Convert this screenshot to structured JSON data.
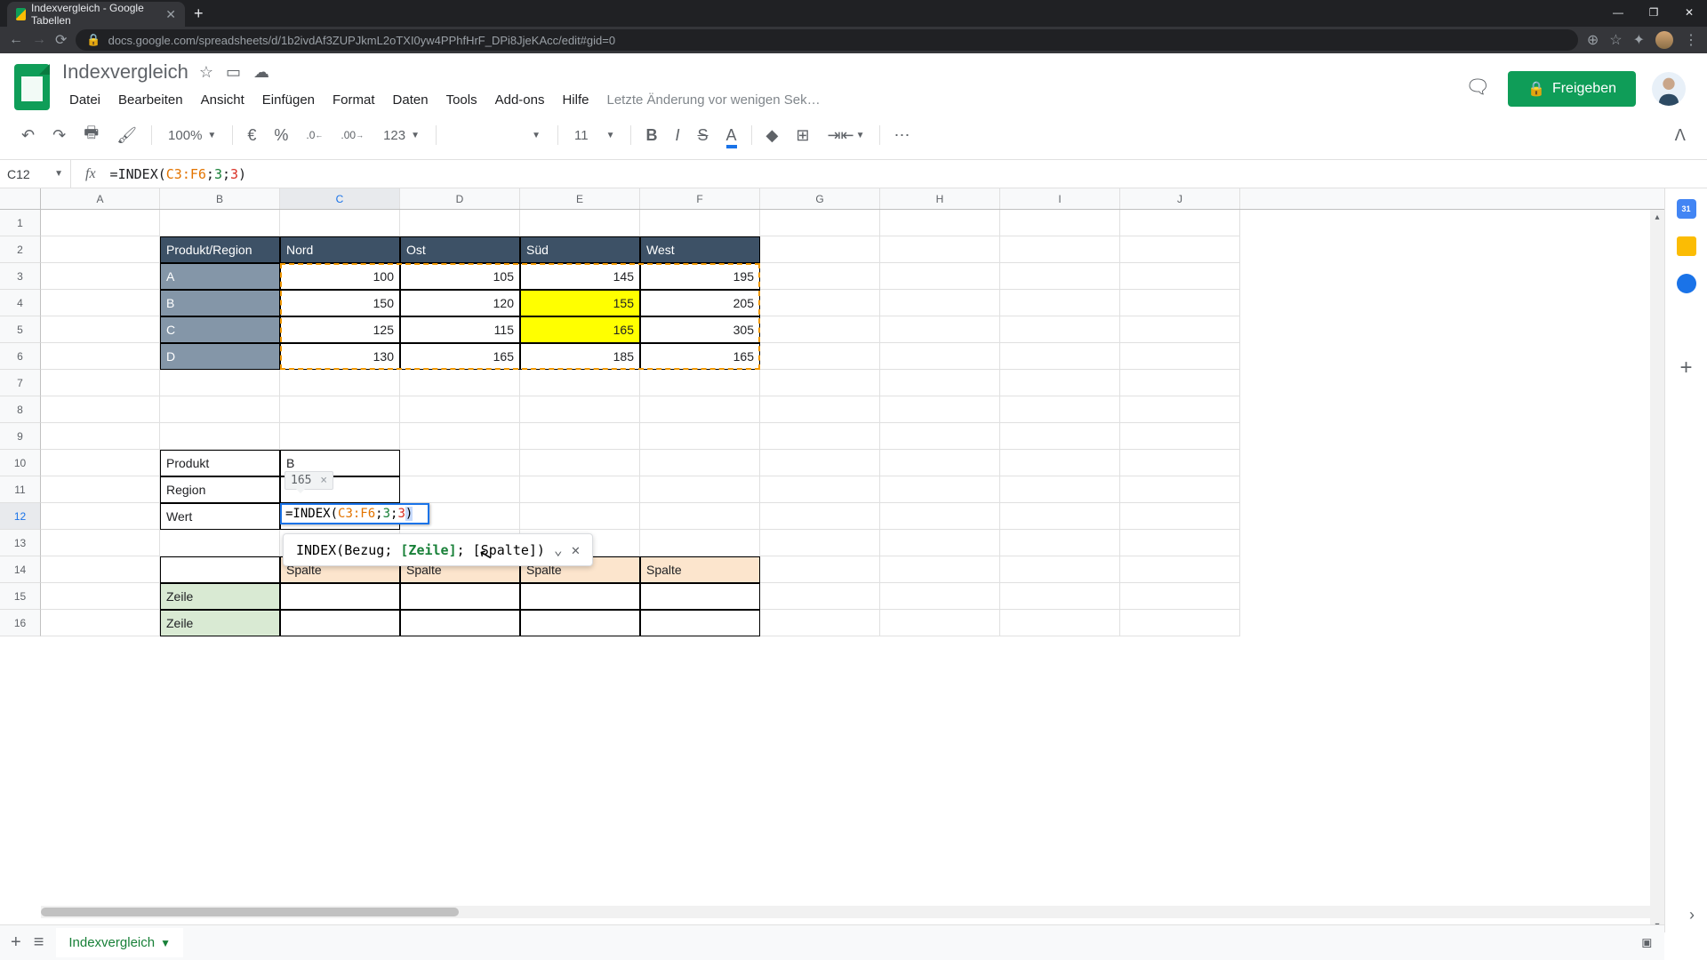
{
  "browser": {
    "tab_title": "Indexvergleich - Google Tabellen",
    "url": "docs.google.com/spreadsheets/d/1b2ivdAf3ZUPJkmL2oTXI0yw4PPhfHrF_DPi8JjeKAcc/edit#gid=0",
    "new_tab": "+",
    "win": {
      "min": "—",
      "max": "❐",
      "close": "✕"
    }
  },
  "doc_title": "Indexvergleich",
  "menu": [
    "Datei",
    "Bearbeiten",
    "Ansicht",
    "Einfügen",
    "Format",
    "Daten",
    "Tools",
    "Add-ons",
    "Hilfe"
  ],
  "last_edit": "Letzte Änderung vor wenigen Sek…",
  "share_label": "Freigeben",
  "toolbar": {
    "zoom": "100%",
    "currency": "€",
    "percent": "%",
    "dec_dec": ".0",
    "dec_inc": ".00",
    "numfmt": "123",
    "font_size": "11"
  },
  "name_box": "C12",
  "formula": {
    "pre": "=INDEX(",
    "range": "C3:F6",
    "sep1": ";",
    "row": "3",
    "sep2": ";",
    "col": "3",
    "post": ")"
  },
  "columns": [
    "A",
    "B",
    "C",
    "D",
    "E",
    "F",
    "G",
    "H",
    "I",
    "J"
  ],
  "rows": [
    "1",
    "2",
    "3",
    "4",
    "5",
    "6",
    "7",
    "8",
    "9",
    "10",
    "11",
    "12",
    "13",
    "14",
    "15",
    "16"
  ],
  "table": {
    "header_corner": "Produkt/Region",
    "regions": [
      "Nord",
      "Ost",
      "Süd",
      "West"
    ],
    "products": [
      "A",
      "B",
      "C",
      "D"
    ],
    "values": [
      [
        100,
        105,
        145,
        195
      ],
      [
        150,
        120,
        155,
        205
      ],
      [
        125,
        115,
        165,
        305
      ],
      [
        130,
        165,
        185,
        165
      ]
    ]
  },
  "lookup": {
    "produkt_lbl": "Produkt",
    "produkt_val": "B",
    "region_lbl": "Region",
    "region_val": "",
    "wert_lbl": "Wert"
  },
  "preview": "165",
  "editing_formula": {
    "pre": "=INDEX(",
    "range": "C3:F6",
    "row": "3",
    "col": "3"
  },
  "helper": {
    "fn": "INDEX(",
    "p1": "Bezug; ",
    "p2": "[Zeile]",
    "p3": "; [Spalte])"
  },
  "matrix": {
    "spalte": "Spalte",
    "zeile": "Zeile"
  },
  "sheet_tab": "Indexvergleich"
}
